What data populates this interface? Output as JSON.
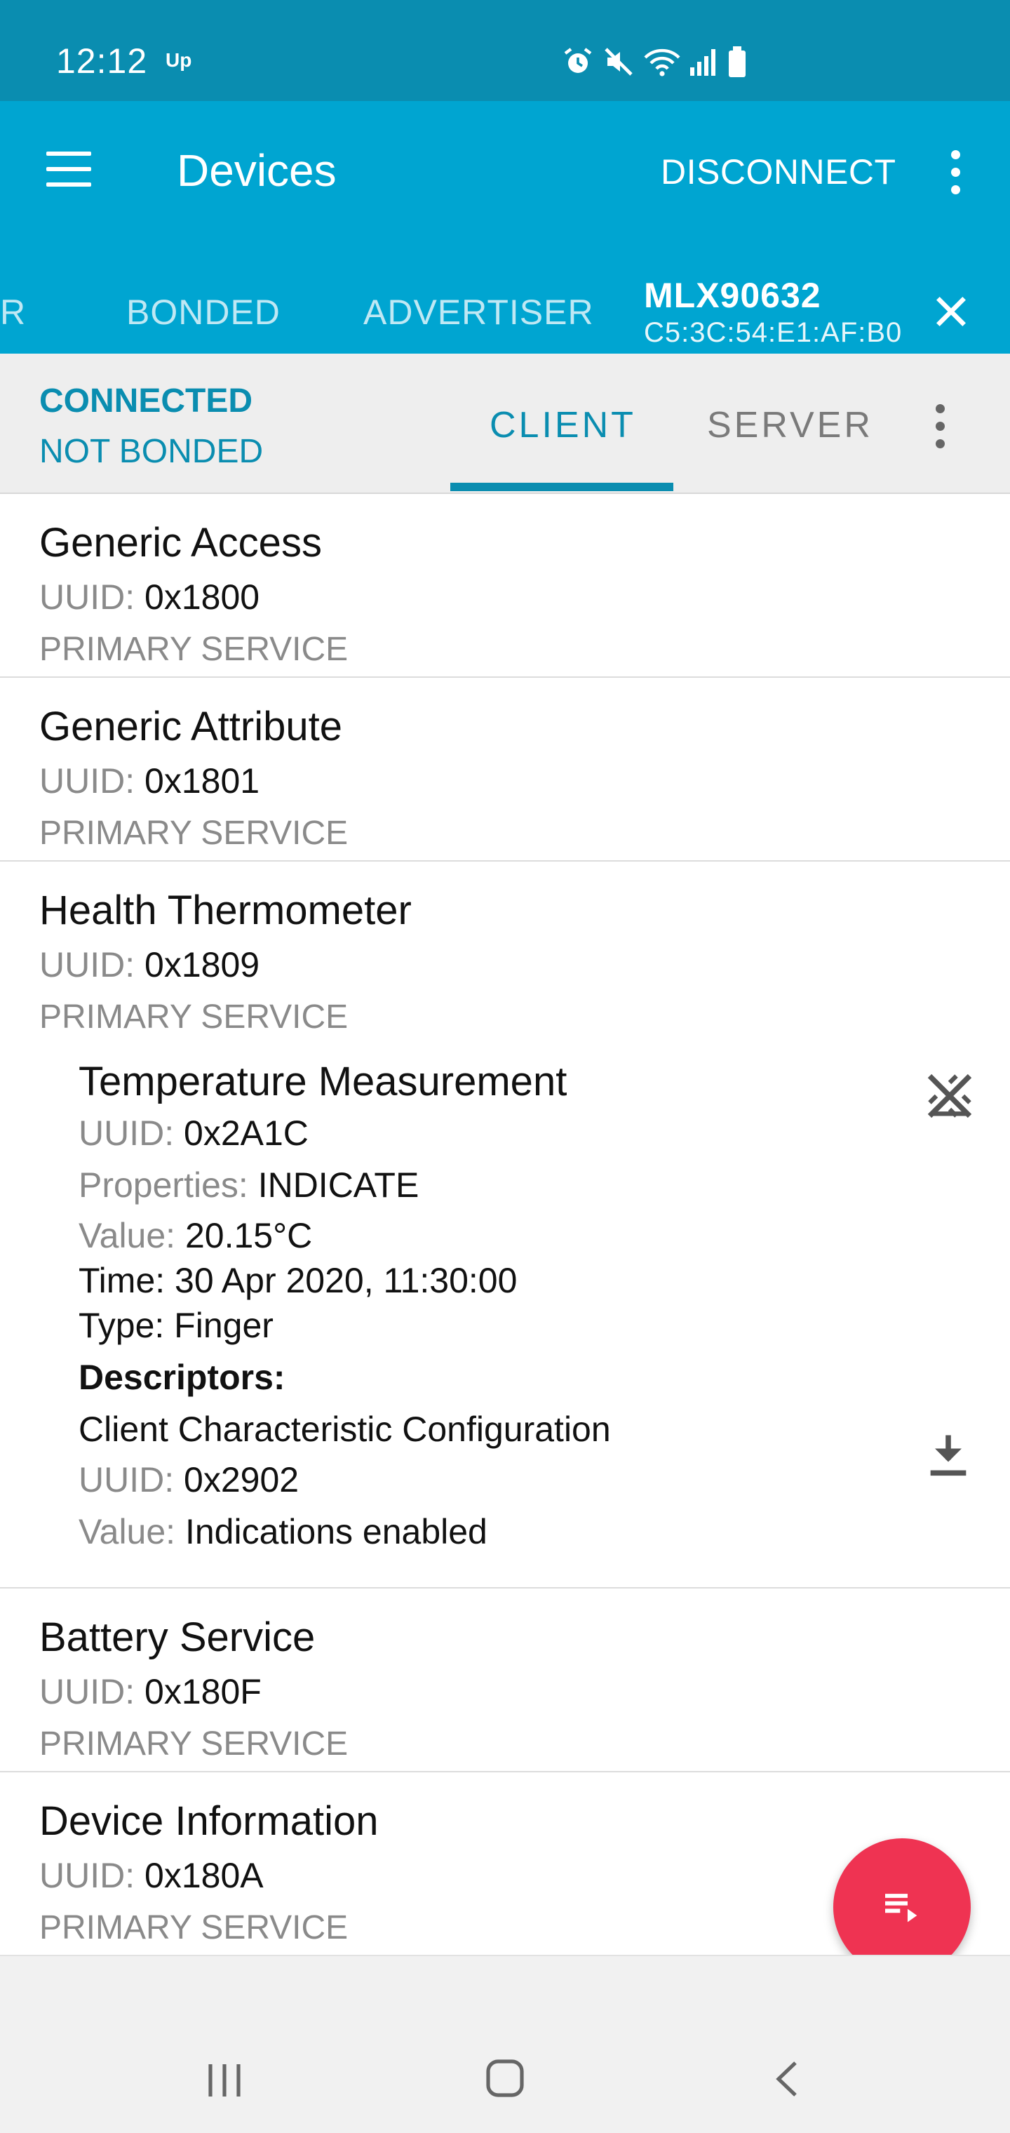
{
  "status_bar": {
    "time": "12:12",
    "carrier_badge": "Up",
    "icons": [
      "alarm-icon",
      "mute-icon",
      "wifi-icon",
      "signal-icon",
      "battery-icon"
    ]
  },
  "app_bar": {
    "title": "Devices",
    "disconnect_label": "DISCONNECT",
    "menu_icon": "hamburger-icon",
    "overflow_icon": "more-vert-icon"
  },
  "device_tabs": {
    "partial_tab": "R",
    "bonded": "BONDED",
    "advertiser": "ADVERTISER",
    "device_name": "MLX90632",
    "device_mac": "C5:3C:54:E1:AF:B0",
    "close_icon": "close-icon"
  },
  "connection": {
    "state": "CONNECTED",
    "bond_state": "NOT BONDED",
    "client_tab": "CLIENT",
    "server_tab": "SERVER"
  },
  "labels": {
    "uuid": "UUID:",
    "properties": "Properties:",
    "value": "Value:",
    "primary_service": "PRIMARY SERVICE",
    "descriptors": "Descriptors:"
  },
  "services": [
    {
      "name": "Generic Access",
      "uuid": "0x1800",
      "type": "PRIMARY SERVICE"
    },
    {
      "name": "Generic Attribute",
      "uuid": "0x1801",
      "type": "PRIMARY SERVICE"
    },
    {
      "name": "Health Thermometer",
      "uuid": "0x1809",
      "type": "PRIMARY SERVICE"
    },
    {
      "name": "Battery Service",
      "uuid": "0x180F",
      "type": "PRIMARY SERVICE"
    },
    {
      "name": "Device Information",
      "uuid": "0x180A",
      "type": "PRIMARY SERVICE"
    }
  ],
  "characteristic": {
    "name": "Temperature Measurement",
    "uuid": "0x2A1C",
    "properties": "INDICATE",
    "value": "20.15°C",
    "time": "Time: 30 Apr 2020, 11:30:00",
    "type": "Type: Finger",
    "action_icon": "indications-off-icon",
    "descriptor": {
      "name": "Client Characteristic Configuration",
      "uuid": "0x2902",
      "value": "Indications enabled",
      "action_icon": "download-icon"
    }
  },
  "fab": {
    "icon": "playlist-play-icon"
  },
  "nav_bar": {
    "recent_icon": "recent-apps-icon",
    "home_icon": "home-icon",
    "back_icon": "back-icon"
  },
  "colors": {
    "status_bar": "#0a8db0",
    "app_bar": "#00a5d1",
    "accent": "#0a8db0",
    "fab": "#ef3352"
  }
}
